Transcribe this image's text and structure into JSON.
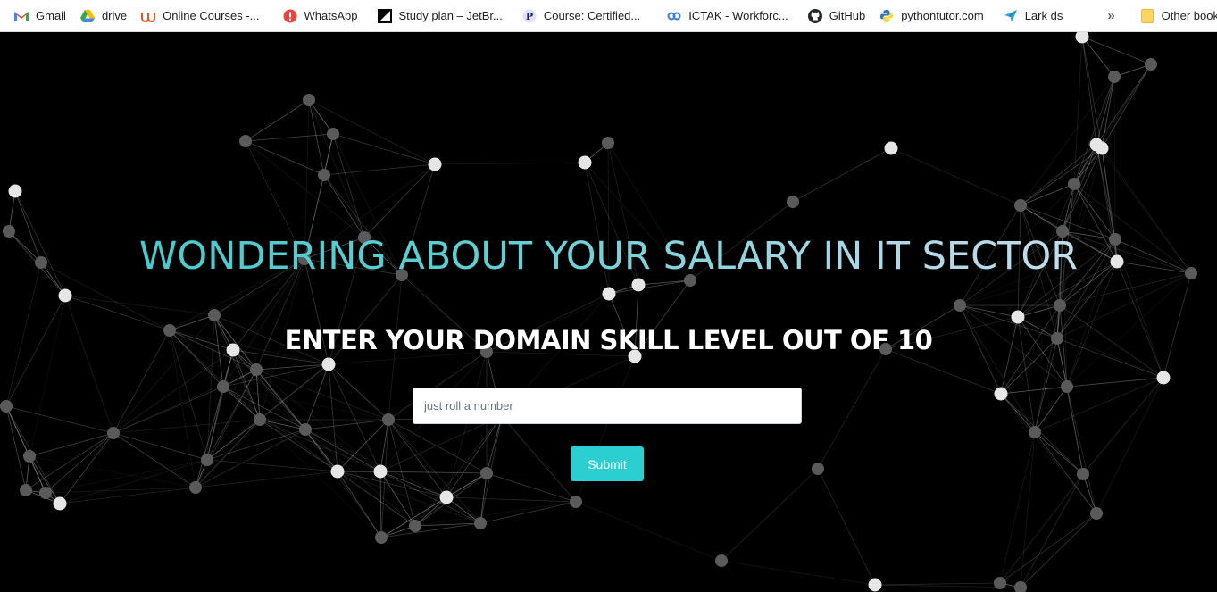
{
  "bookmarks": [
    {
      "label": "Gmail",
      "icon": "gmail-icon"
    },
    {
      "label": "drive",
      "icon": "drive-icon"
    },
    {
      "label": "Online Courses -...",
      "icon": "udemy-icon"
    },
    {
      "label": "WhatsApp",
      "icon": "whatsapp-icon"
    },
    {
      "label": "Study plan – JetBr...",
      "icon": "jetbrains-icon"
    },
    {
      "label": "Course: Certified...",
      "icon": "course-icon"
    },
    {
      "label": "ICTAK - Workforc...",
      "icon": "ictak-icon"
    },
    {
      "label": "GitHub",
      "icon": "github-icon"
    },
    {
      "label": "pythontutor.com",
      "icon": "python-icon"
    },
    {
      "label": "Lark ds",
      "icon": "lark-icon"
    }
  ],
  "bookmarks_overflow": "»",
  "other_bookmarks": "Other bookmarks",
  "hero": {
    "title": "WONDERING ABOUT YOUR SALARY IN IT SECTOR",
    "subtitle": "ENTER YOUR DOMAIN SKILL LEVEL OUT OF 10",
    "input_placeholder": "just roll a number",
    "input_value": "",
    "submit_label": "Submit"
  },
  "colors": {
    "background": "#000000",
    "accent": "#2ccfd1",
    "title_gradient_start": "#3ec9cf",
    "title_gradient_end": "#cfe1ef"
  }
}
